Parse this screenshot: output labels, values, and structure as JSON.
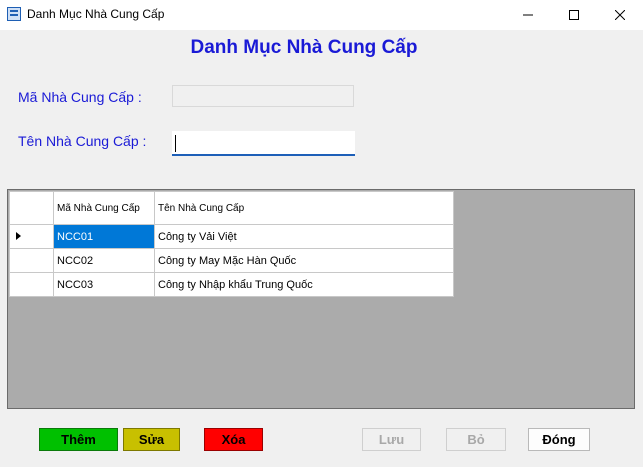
{
  "window": {
    "title": "Danh Mục Nhà Cung Cấp"
  },
  "form": {
    "heading": "Danh Mục Nhà Cung Cấp",
    "ma_label": "Mã Nhà Cung Cấp :",
    "ma_value": "",
    "ten_label": "Tên Nhà Cung Cấp :",
    "ten_value": ""
  },
  "grid": {
    "columns": [
      "Mã Nhà Cung Cấp",
      "Tên Nhà Cung Cấp"
    ],
    "rows": [
      {
        "ma": "NCC01",
        "ten": "Công ty Vải Việt"
      },
      {
        "ma": "NCC02",
        "ten": "Công ty May Mặc Hàn Quốc"
      },
      {
        "ma": "NCC03",
        "ten": "Công ty Nhập khẩu Trung Quốc"
      }
    ],
    "selected_row": 0
  },
  "buttons": {
    "them": "Thêm",
    "sua": "Sửa",
    "xoa": "Xóa",
    "luu": "Lưu",
    "bo": "Bỏ",
    "dong": "Đóng"
  },
  "colors": {
    "label_blue": "#1a1ad6",
    "them_green": "#00c000",
    "sua_olive": "#c8c000",
    "xoa_red": "#ff0000",
    "selection_blue": "#0078d7",
    "grid_background": "#ababab"
  },
  "icons": {
    "app": "app-form-icon",
    "minimize": "minimize-icon",
    "maximize": "maximize-icon",
    "close": "close-icon",
    "row_indicator": "row-pointer-icon"
  }
}
